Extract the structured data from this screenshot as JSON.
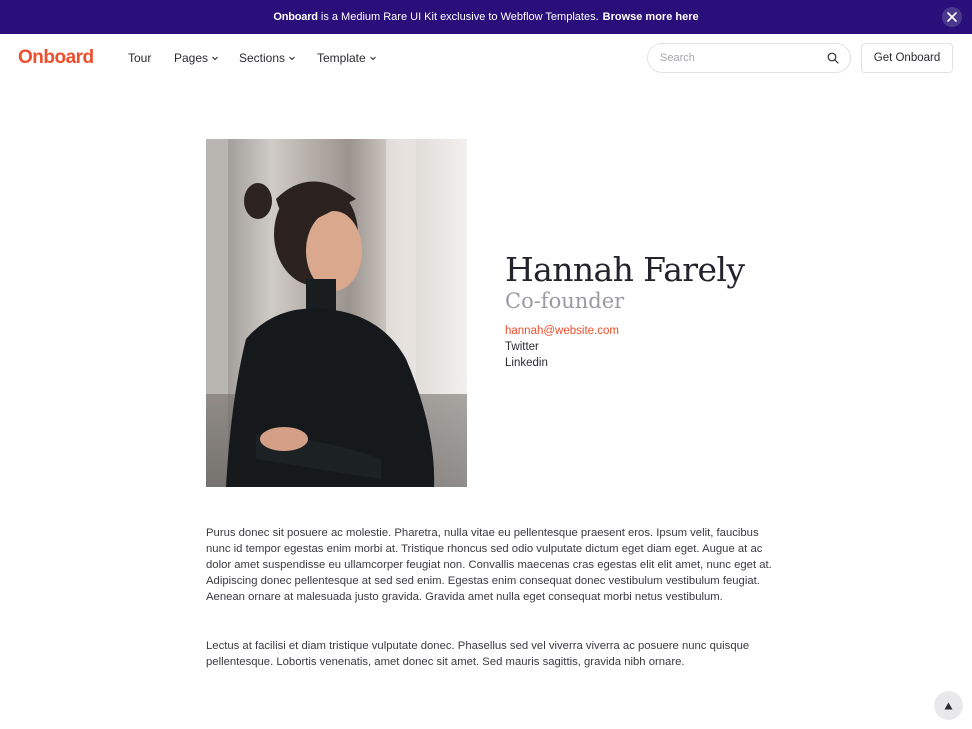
{
  "announcement": {
    "brand": "Onboard",
    "text": " is a Medium Rare UI Kit exclusive to Webflow Templates.",
    "link_label": "Browse more here",
    "close_icon": "close-icon"
  },
  "nav": {
    "logo": "Onboard",
    "items": [
      {
        "label": "Tour",
        "has_dropdown": false
      },
      {
        "label": "Pages",
        "has_dropdown": true
      },
      {
        "label": "Sections",
        "has_dropdown": true
      },
      {
        "label": "Template",
        "has_dropdown": true
      }
    ],
    "search_placeholder": "Search",
    "search_value": "",
    "cta_label": "Get Onboard"
  },
  "profile": {
    "name": "Hannah Farely",
    "role": "Co-founder",
    "email": "hannah@website.com",
    "twitter": "Twitter",
    "linkedin": "Linkedin"
  },
  "body": {
    "paragraph_1": "Purus donec sit posuere ac molestie. Pharetra, nulla vitae eu pellentesque praesent eros. Ipsum velit, faucibus nunc id tempor egestas enim morbi at. Tristique rhoncus sed odio vulputate dictum eget diam eget. Augue at ac dolor amet suspendisse eu ullamcorper feugiat non. Convallis maecenas cras egestas elit elit amet, nunc eget at. Adipiscing donec pellentesque at sed sed enim. Egestas enim consequat donec vestibulum vestibulum feugiat. Aenean ornare at malesuada justo gravida. Gravida amet nulla eget consequat morbi netus vestibulum.",
    "paragraph_2": "Lectus at facilisi et diam tristique vulputate donec. Phasellus sed vel viverra viverra ac posuere nunc quisque pellentesque. Lobortis venenatis, amet donec sit amet. Sed mauris sagittis, gravida nibh ornare."
  },
  "colors": {
    "announcement_bg": "#2a0f7a",
    "accent": "#ef4e2c",
    "text": "#2b2b33",
    "muted": "#9a9aa2"
  }
}
